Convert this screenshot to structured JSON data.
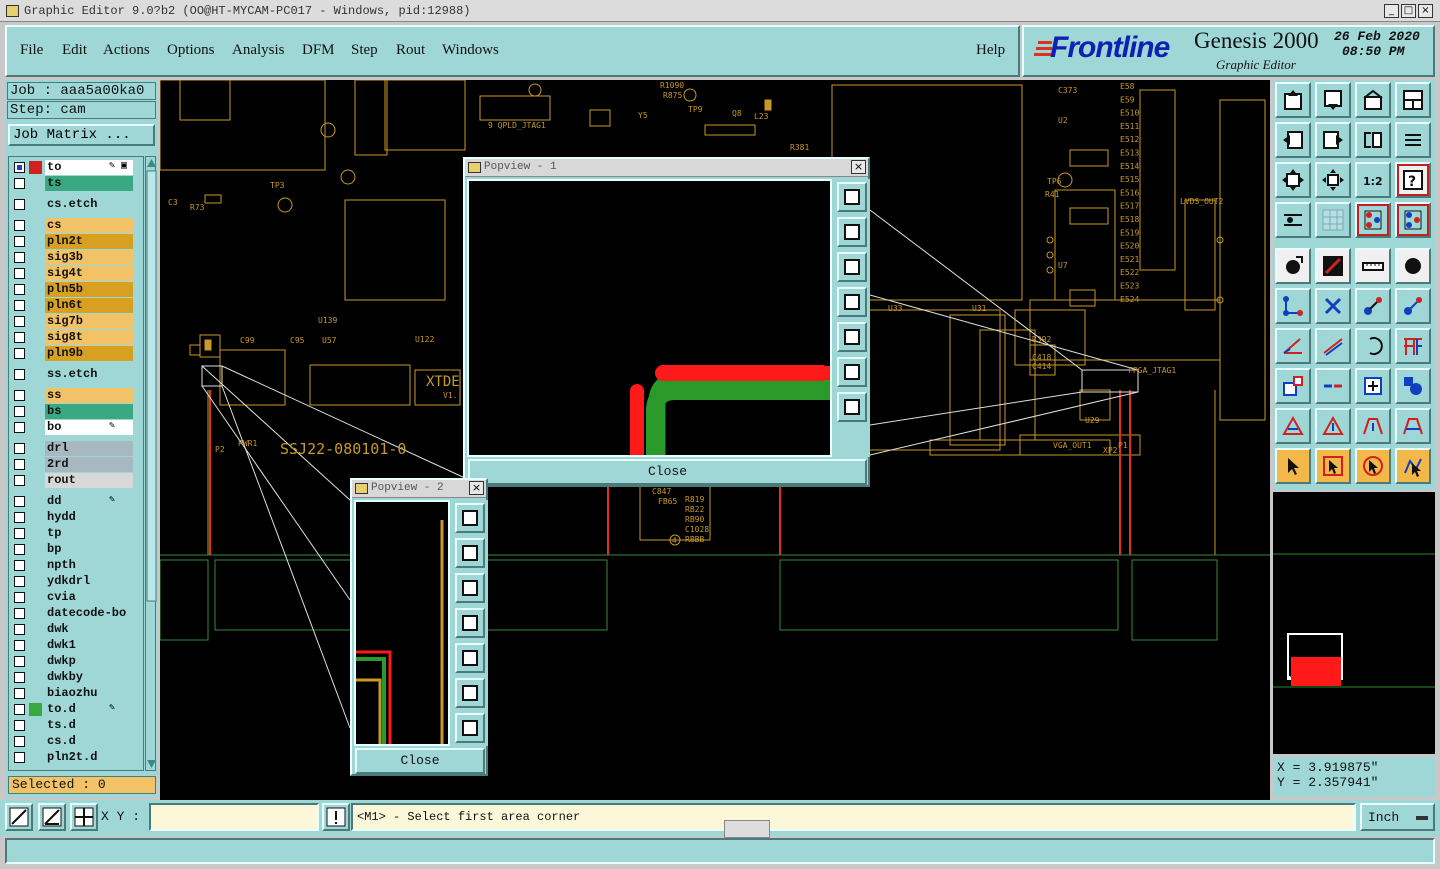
{
  "window": {
    "title": "Graphic Editor 9.0?b2 (OO@HT-MYCAM-PC017 - Windows, pid:12988)",
    "minimize": "_",
    "maximize": "□",
    "close": "×"
  },
  "menu": {
    "items": [
      "File",
      "Edit",
      "Actions",
      "Options",
      "Analysis",
      "DFM",
      "Step",
      "Rout",
      "Windows"
    ],
    "help": "Help"
  },
  "brand": {
    "logo": "Frontline",
    "product": "Genesis 2000",
    "subtitle": "Graphic Editor",
    "date": "26 Feb 2020",
    "time": "08:50 PM"
  },
  "left": {
    "job": "Job : aaa5a00ka0",
    "step": "Step: cam",
    "job_matrix": "Job Matrix ...",
    "selected": "Selected : 0"
  },
  "layers": [
    {
      "name": "to",
      "bg": "#ffffff",
      "mark": "#d02020",
      "check_color": "#2040c0",
      "suffix": "✎ ▣"
    },
    {
      "name": "ts",
      "bg": "#3aa880",
      "mark": "",
      "check_color": "",
      "suffix": ""
    },
    {
      "name": "cs.etch",
      "bg": "#9fd7d7",
      "mark": "",
      "check_color": "",
      "suffix": ""
    },
    {
      "name": "cs",
      "bg": "#f2c266",
      "mark": "",
      "check_color": "",
      "suffix": ""
    },
    {
      "name": "pln2t",
      "bg": "#d8a020",
      "mark": "",
      "check_color": "",
      "suffix": ""
    },
    {
      "name": "sig3b",
      "bg": "#f2c266",
      "mark": "",
      "check_color": "",
      "suffix": ""
    },
    {
      "name": "sig4t",
      "bg": "#f2c266",
      "mark": "",
      "check_color": "",
      "suffix": ""
    },
    {
      "name": "pln5b",
      "bg": "#d8a020",
      "mark": "",
      "check_color": "",
      "suffix": ""
    },
    {
      "name": "pln6t",
      "bg": "#d8a020",
      "mark": "",
      "check_color": "",
      "suffix": ""
    },
    {
      "name": "sig7b",
      "bg": "#f2c266",
      "mark": "",
      "check_color": "",
      "suffix": ""
    },
    {
      "name": "sig8t",
      "bg": "#f2c266",
      "mark": "",
      "check_color": "",
      "suffix": ""
    },
    {
      "name": "pln9b",
      "bg": "#d8a020",
      "mark": "",
      "check_color": "",
      "suffix": ""
    },
    {
      "name": "ss.etch",
      "bg": "#9fd7d7",
      "mark": "",
      "check_color": "",
      "suffix": ""
    },
    {
      "name": "ss",
      "bg": "#f2c266",
      "mark": "",
      "check_color": "",
      "suffix": ""
    },
    {
      "name": "bs",
      "bg": "#3aa880",
      "mark": "",
      "check_color": "",
      "suffix": ""
    },
    {
      "name": "bo",
      "bg": "#ffffff",
      "mark": "",
      "check_color": "",
      "suffix": "✎"
    },
    {
      "name": "drl",
      "bg": "#a8b8c0",
      "mark": "",
      "check_color": "",
      "suffix": ""
    },
    {
      "name": "2rd",
      "bg": "#a8b8c0",
      "mark": "",
      "check_color": "",
      "suffix": ""
    },
    {
      "name": "rout",
      "bg": "#d8d8d8",
      "mark": "",
      "check_color": "",
      "suffix": ""
    },
    {
      "name": "dd",
      "bg": "#9fd7d7",
      "mark": "",
      "check_color": "",
      "suffix": "✎"
    },
    {
      "name": "hydd",
      "bg": "#9fd7d7",
      "mark": "",
      "check_color": "",
      "suffix": ""
    },
    {
      "name": "tp",
      "bg": "#9fd7d7",
      "mark": "",
      "check_color": "",
      "suffix": ""
    },
    {
      "name": "bp",
      "bg": "#9fd7d7",
      "mark": "",
      "check_color": "",
      "suffix": ""
    },
    {
      "name": "npth",
      "bg": "#9fd7d7",
      "mark": "",
      "check_color": "",
      "suffix": ""
    },
    {
      "name": "ydkdrl",
      "bg": "#9fd7d7",
      "mark": "",
      "check_color": "",
      "suffix": ""
    },
    {
      "name": "cvia",
      "bg": "#9fd7d7",
      "mark": "",
      "check_color": "",
      "suffix": ""
    },
    {
      "name": "datecode-bo",
      "bg": "#9fd7d7",
      "mark": "",
      "check_color": "",
      "suffix": ""
    },
    {
      "name": "dwk",
      "bg": "#9fd7d7",
      "mark": "",
      "check_color": "",
      "suffix": ""
    },
    {
      "name": "dwk1",
      "bg": "#9fd7d7",
      "mark": "",
      "check_color": "",
      "suffix": ""
    },
    {
      "name": "dwkp",
      "bg": "#9fd7d7",
      "mark": "",
      "check_color": "",
      "suffix": ""
    },
    {
      "name": "dwkby",
      "bg": "#9fd7d7",
      "mark": "",
      "check_color": "",
      "suffix": ""
    },
    {
      "name": "biaozhu",
      "bg": "#9fd7d7",
      "mark": "",
      "check_color": "",
      "suffix": ""
    },
    {
      "name": "to.d",
      "bg": "#9fd7d7",
      "mark": "#3aa840",
      "check_color": "",
      "suffix": "✎"
    },
    {
      "name": "ts.d",
      "bg": "#9fd7d7",
      "mark": "",
      "check_color": "",
      "suffix": ""
    },
    {
      "name": "cs.d",
      "bg": "#9fd7d7",
      "mark": "",
      "check_color": "",
      "suffix": ""
    },
    {
      "name": "pln2t.d",
      "bg": "#9fd7d7",
      "mark": "",
      "check_color": "",
      "suffix": ""
    }
  ],
  "bottom": {
    "xy_label": "X Y :",
    "xy_value": "",
    "message": "<M1> - Select first area corner",
    "units": "Inch"
  },
  "coords": {
    "x": "X = 3.919875\"",
    "y": "Y = 2.357941\""
  },
  "popview1": {
    "title": "Popview - 1",
    "close": "Close"
  },
  "popview2": {
    "title": "Popview - 2",
    "close": "Close"
  },
  "canvas_labels": {
    "ssj": "SSJ22-080101-0",
    "xtde": "XTDE",
    "v1": "V1.",
    "pwr1": "PWR1",
    "p2": "P2",
    "u139": "U139",
    "u122": "U122",
    "u57": "U57",
    "c99": "C99",
    "c95": "C95",
    "r74": "R74",
    "tp3": "TP3",
    "r73": "R73",
    "c5": "C5",
    "c6": "C6",
    "c7": "C7",
    "qpld": "9  QPLD_JTAG1",
    "r1090": "R1090",
    "r875": "R875",
    "tp9": "TP9",
    "y5": "Y5",
    "q8": "Q8",
    "l23": "L23",
    "r378": "R378",
    "r381": "R381",
    "u31": "U31",
    "u32": "U32",
    "u33": "U33",
    "u29": "U29",
    "u7": "U7",
    "u2": "U2",
    "c373": "C373",
    "lvds_out2": "LVDS_OUT2",
    "lvds": "LVDS",
    "fpga_jtag1": "FPGA_JTAG1",
    "vga_out1": "VGA_OUT1",
    "xp2": "XP2",
    "p1": "P1",
    "tp6": "TP6",
    "r41": "R41",
    "r392": "R392",
    "c418": "C418",
    "c414": "C414",
    "c415": "C415",
    "c416": "C416",
    "c54": "C54",
    "c847": "C847",
    "fb65": "FB65",
    "r819": "R819",
    "rb22": "RB22",
    "rb90": "RB90",
    "c1028": "C1028",
    "rbbb": "RBBB",
    "cb41": "CB41",
    "q4": "4",
    "es_labels": [
      "E58",
      "E59",
      "E510",
      "E511",
      "E512",
      "E513",
      "E514",
      "E515",
      "E516",
      "E517",
      "E518",
      "E519",
      "E520",
      "E521",
      "E522",
      "E523",
      "E524"
    ]
  }
}
